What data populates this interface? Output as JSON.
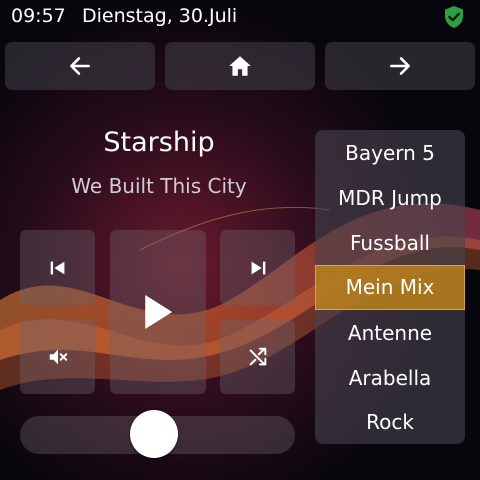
{
  "status": {
    "time": "09:57",
    "date": "Dienstag, 30.Juli"
  },
  "nav": {
    "back_icon": "arrow-left-icon",
    "home_icon": "home-icon",
    "forward_icon": "arrow-right-icon"
  },
  "player": {
    "artist": "Starship",
    "title": "We Built This City",
    "state": "paused",
    "volume_fraction": 0.56
  },
  "stations": {
    "items": [
      {
        "label": "Bayern 5"
      },
      {
        "label": "MDR Jump"
      },
      {
        "label": "Fussball"
      },
      {
        "label": "Mein Mix"
      },
      {
        "label": "Antenne"
      },
      {
        "label": "Arabella"
      },
      {
        "label": "Rock"
      }
    ],
    "selected": "Mein Mix"
  },
  "colors": {
    "accent": "#b8801c",
    "shield": "#2ea043"
  }
}
